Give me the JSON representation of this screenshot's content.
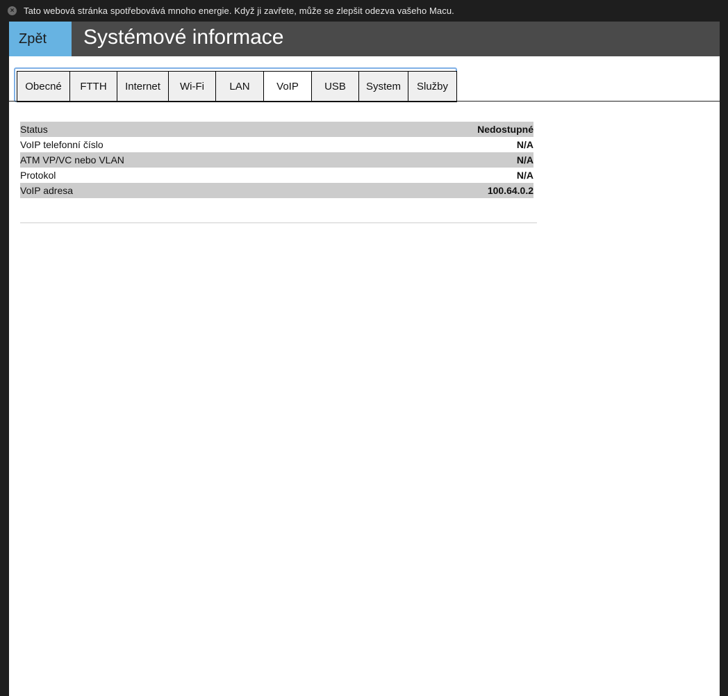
{
  "notification": {
    "text": "Tato webová stránka spotřebovává mnoho energie. Když ji zavřete, může se zlepšit odezva vašeho Macu."
  },
  "header": {
    "back_label": "Zpět",
    "title": "Systémové informace"
  },
  "tabs": [
    {
      "label": "Obecné"
    },
    {
      "label": "FTTH"
    },
    {
      "label": "Internet"
    },
    {
      "label": "Wi-Fi"
    },
    {
      "label": "LAN"
    },
    {
      "label": "VoIP",
      "active": true
    },
    {
      "label": "USB"
    },
    {
      "label": "System"
    },
    {
      "label": "Služby"
    }
  ],
  "voip_table": {
    "rows": [
      {
        "label": "Status",
        "value": "Nedostupné"
      },
      {
        "label": "VoIP telefonní číslo",
        "value": "N/A"
      },
      {
        "label": "ATM VP/VC nebo VLAN",
        "value": "N/A"
      },
      {
        "label": "Protokol",
        "value": "N/A"
      },
      {
        "label": "VoIP adresa",
        "value": "100.64.0.2"
      }
    ]
  },
  "colors": {
    "header_bg": "#4a4a4a",
    "back_button_bg": "#67b3e2",
    "row_shade": "#cccccc",
    "tab_focus_ring": "#7fb0e6"
  }
}
